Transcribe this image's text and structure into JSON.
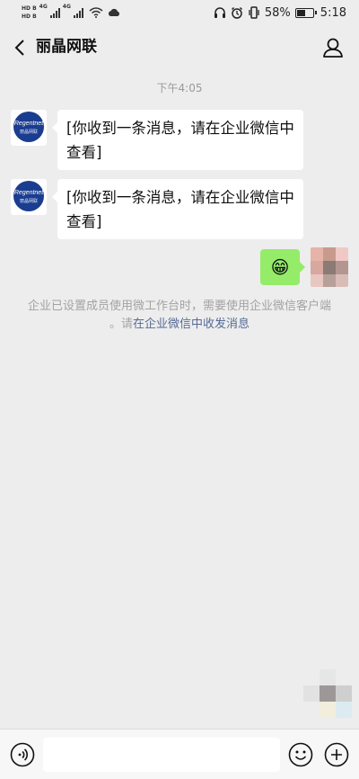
{
  "status_bar": {
    "hd_top": "HD B",
    "hd_bottom": "HD B",
    "net1": "4G",
    "net2": "4G",
    "battery_percent_text": "58%",
    "battery_level": 0.58,
    "time": "5:18"
  },
  "header": {
    "title": "丽晶网联"
  },
  "chat": {
    "timestamp": "下午4:05",
    "contact_avatar": {
      "brand": "Regentnet",
      "brand_sub": "丽晶网联"
    },
    "messages": [
      {
        "text": "[你收到一条消息，请在企业微信中查看]"
      },
      {
        "text": "[你收到一条消息，请在企业微信中查看]"
      }
    ],
    "sent_emoji": "😁",
    "notice_text": "企业已设置成员使用微工作台时，需要使用企业微信客户端 。请",
    "notice_link": "在企业微信中收发消息"
  },
  "icons": {
    "back": "chevron-left-icon",
    "profile": "person-icon",
    "voice": "voice-icon",
    "emoji": "smiley-icon",
    "plus": "plus-icon"
  },
  "colors": {
    "background": "#ededed",
    "sent_bubble": "#95ec69",
    "link": "#576b95",
    "avatar_brand": "#1b3d8f"
  }
}
